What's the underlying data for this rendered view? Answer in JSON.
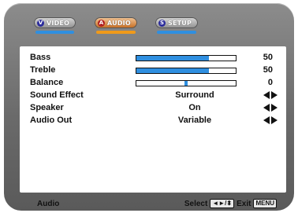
{
  "tabs": [
    {
      "label": "VIDEO",
      "badge": "V",
      "active": false
    },
    {
      "label": "AUDIO",
      "badge": "A",
      "active": true
    },
    {
      "label": "SETUP",
      "badge": "S",
      "active": false
    }
  ],
  "settings": [
    {
      "label": "Bass",
      "type": "bar",
      "value": "50",
      "level": 0.73
    },
    {
      "label": "Treble",
      "type": "bar",
      "value": "50",
      "level": 0.73
    },
    {
      "label": "Balance",
      "type": "balance",
      "value": "0",
      "level": 0.5
    },
    {
      "label": "Sound Effect",
      "type": "option",
      "option": "Surround"
    },
    {
      "label": "Speaker",
      "type": "option",
      "option": "On"
    },
    {
      "label": "Audio Out",
      "type": "option",
      "option": "Variable"
    }
  ],
  "footer": {
    "title": "Audio",
    "select_label": "Select",
    "select_keys": "◄►/⬍",
    "exit_label": "Exit",
    "exit_key": "MENU"
  },
  "colors": {
    "accent": "#2f8fe0",
    "active_tab": "#f09a1a"
  }
}
